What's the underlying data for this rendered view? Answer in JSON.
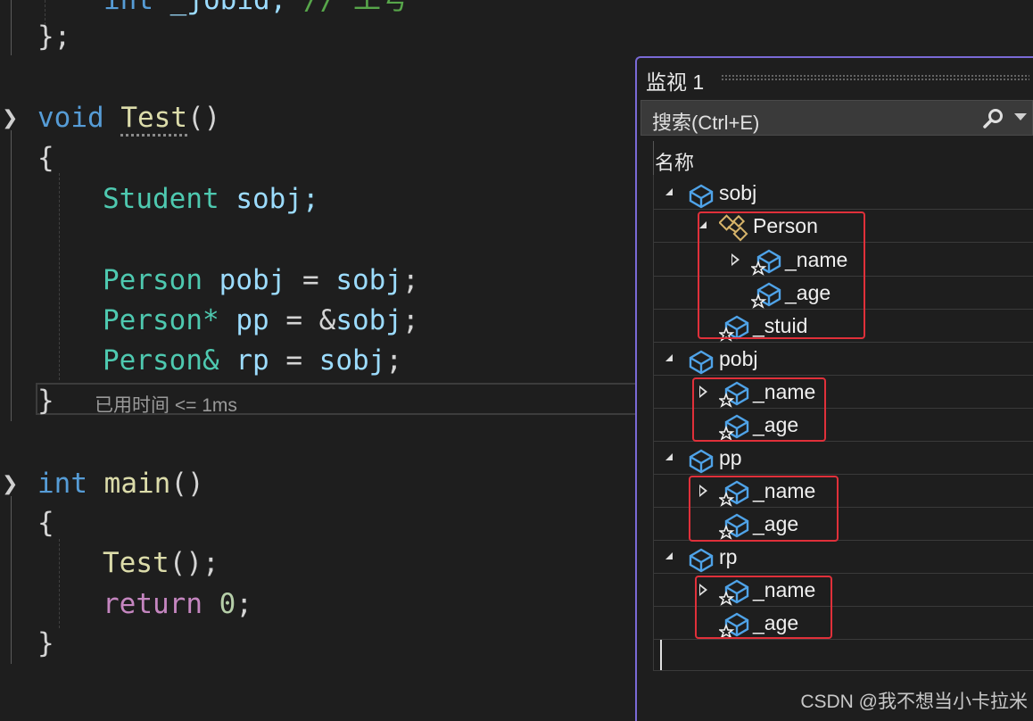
{
  "editor": {
    "top_fragment": {
      "type": "int",
      "name": "_jobid;",
      "comment": "// 工号"
    },
    "struct_close": "};",
    "test_func": {
      "ret": "void",
      "name": "Test",
      "parens": "()"
    },
    "test_body": {
      "open_brace": "{",
      "l1": {
        "type": "Student",
        "rest": "sobj;"
      },
      "l2": {
        "type": "Person",
        "var": "pobj",
        "op": " = ",
        "val": "sobj",
        "end": ";"
      },
      "l3": {
        "type": "Person*",
        "var": "pp",
        "op": " = &",
        "val": "sobj",
        "end": ";"
      },
      "l4": {
        "type": "Person&",
        "var": "rp",
        "op": " = ",
        "val": "sobj",
        "end": ";"
      },
      "close_brace": "}",
      "elapsed": "已用时间 <= 1ms"
    },
    "main_func": {
      "ret": "int",
      "name": "main",
      "parens": "()"
    },
    "main_body": {
      "open_brace": "{",
      "call": "Test",
      "call_rest": "();",
      "ret_kw": "return",
      "ret_val": "0",
      "ret_end": ";",
      "close_brace": "}"
    }
  },
  "watch": {
    "title": "监视 1",
    "search_placeholder": "搜索(Ctrl+E)",
    "column_header": "名称",
    "rows": [
      {
        "label": "sobj",
        "icon": "object-icon",
        "expanded": true
      },
      {
        "label": "Person",
        "icon": "base-class-icon",
        "expanded": true
      },
      {
        "label": "_name",
        "icon": "member-icon",
        "expanded": false
      },
      {
        "label": "_age",
        "icon": "member-icon"
      },
      {
        "label": "_stuid",
        "icon": "member-icon"
      },
      {
        "label": "pobj",
        "icon": "object-icon",
        "expanded": true
      },
      {
        "label": "_name",
        "icon": "member-icon",
        "expanded": false
      },
      {
        "label": "_age",
        "icon": "member-icon"
      },
      {
        "label": "pp",
        "icon": "object-icon",
        "expanded": true
      },
      {
        "label": "_name",
        "icon": "member-icon",
        "expanded": false
      },
      {
        "label": "_age",
        "icon": "member-icon"
      },
      {
        "label": "rp",
        "icon": "object-icon",
        "expanded": true
      },
      {
        "label": "_name",
        "icon": "member-icon",
        "expanded": false
      },
      {
        "label": "_age",
        "icon": "member-icon"
      }
    ],
    "highlight_color": "#e0303a",
    "accent_color": "#7a6ad6"
  },
  "watermark": "CSDN @我不想当小卡拉米"
}
